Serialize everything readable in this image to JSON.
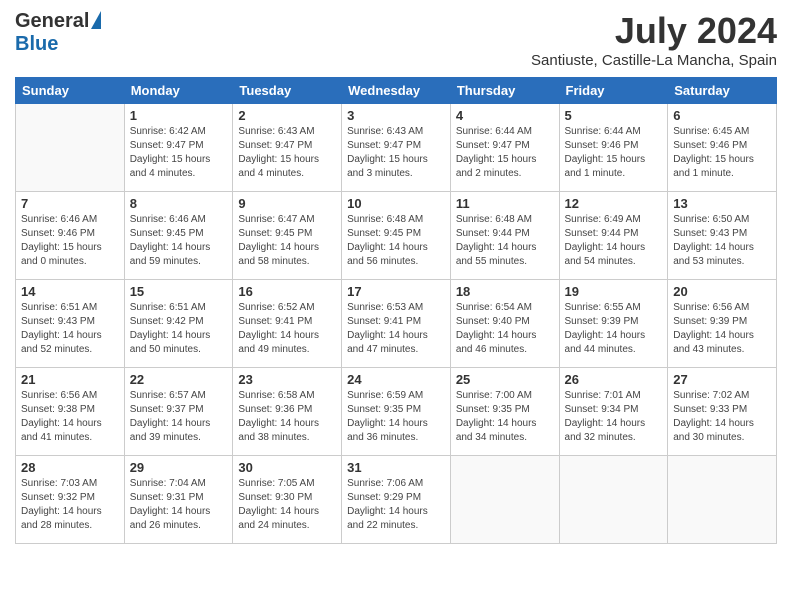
{
  "header": {
    "logo_general": "General",
    "logo_blue": "Blue",
    "month_year": "July 2024",
    "location": "Santiuste, Castille-La Mancha, Spain"
  },
  "weekdays": [
    "Sunday",
    "Monday",
    "Tuesday",
    "Wednesday",
    "Thursday",
    "Friday",
    "Saturday"
  ],
  "weeks": [
    [
      {
        "day": "",
        "info": ""
      },
      {
        "day": "1",
        "info": "Sunrise: 6:42 AM\nSunset: 9:47 PM\nDaylight: 15 hours\nand 4 minutes."
      },
      {
        "day": "2",
        "info": "Sunrise: 6:43 AM\nSunset: 9:47 PM\nDaylight: 15 hours\nand 4 minutes."
      },
      {
        "day": "3",
        "info": "Sunrise: 6:43 AM\nSunset: 9:47 PM\nDaylight: 15 hours\nand 3 minutes."
      },
      {
        "day": "4",
        "info": "Sunrise: 6:44 AM\nSunset: 9:47 PM\nDaylight: 15 hours\nand 2 minutes."
      },
      {
        "day": "5",
        "info": "Sunrise: 6:44 AM\nSunset: 9:46 PM\nDaylight: 15 hours\nand 1 minute."
      },
      {
        "day": "6",
        "info": "Sunrise: 6:45 AM\nSunset: 9:46 PM\nDaylight: 15 hours\nand 1 minute."
      }
    ],
    [
      {
        "day": "7",
        "info": "Sunrise: 6:46 AM\nSunset: 9:46 PM\nDaylight: 15 hours\nand 0 minutes."
      },
      {
        "day": "8",
        "info": "Sunrise: 6:46 AM\nSunset: 9:45 PM\nDaylight: 14 hours\nand 59 minutes."
      },
      {
        "day": "9",
        "info": "Sunrise: 6:47 AM\nSunset: 9:45 PM\nDaylight: 14 hours\nand 58 minutes."
      },
      {
        "day": "10",
        "info": "Sunrise: 6:48 AM\nSunset: 9:45 PM\nDaylight: 14 hours\nand 56 minutes."
      },
      {
        "day": "11",
        "info": "Sunrise: 6:48 AM\nSunset: 9:44 PM\nDaylight: 14 hours\nand 55 minutes."
      },
      {
        "day": "12",
        "info": "Sunrise: 6:49 AM\nSunset: 9:44 PM\nDaylight: 14 hours\nand 54 minutes."
      },
      {
        "day": "13",
        "info": "Sunrise: 6:50 AM\nSunset: 9:43 PM\nDaylight: 14 hours\nand 53 minutes."
      }
    ],
    [
      {
        "day": "14",
        "info": "Sunrise: 6:51 AM\nSunset: 9:43 PM\nDaylight: 14 hours\nand 52 minutes."
      },
      {
        "day": "15",
        "info": "Sunrise: 6:51 AM\nSunset: 9:42 PM\nDaylight: 14 hours\nand 50 minutes."
      },
      {
        "day": "16",
        "info": "Sunrise: 6:52 AM\nSunset: 9:41 PM\nDaylight: 14 hours\nand 49 minutes."
      },
      {
        "day": "17",
        "info": "Sunrise: 6:53 AM\nSunset: 9:41 PM\nDaylight: 14 hours\nand 47 minutes."
      },
      {
        "day": "18",
        "info": "Sunrise: 6:54 AM\nSunset: 9:40 PM\nDaylight: 14 hours\nand 46 minutes."
      },
      {
        "day": "19",
        "info": "Sunrise: 6:55 AM\nSunset: 9:39 PM\nDaylight: 14 hours\nand 44 minutes."
      },
      {
        "day": "20",
        "info": "Sunrise: 6:56 AM\nSunset: 9:39 PM\nDaylight: 14 hours\nand 43 minutes."
      }
    ],
    [
      {
        "day": "21",
        "info": "Sunrise: 6:56 AM\nSunset: 9:38 PM\nDaylight: 14 hours\nand 41 minutes."
      },
      {
        "day": "22",
        "info": "Sunrise: 6:57 AM\nSunset: 9:37 PM\nDaylight: 14 hours\nand 39 minutes."
      },
      {
        "day": "23",
        "info": "Sunrise: 6:58 AM\nSunset: 9:36 PM\nDaylight: 14 hours\nand 38 minutes."
      },
      {
        "day": "24",
        "info": "Sunrise: 6:59 AM\nSunset: 9:35 PM\nDaylight: 14 hours\nand 36 minutes."
      },
      {
        "day": "25",
        "info": "Sunrise: 7:00 AM\nSunset: 9:35 PM\nDaylight: 14 hours\nand 34 minutes."
      },
      {
        "day": "26",
        "info": "Sunrise: 7:01 AM\nSunset: 9:34 PM\nDaylight: 14 hours\nand 32 minutes."
      },
      {
        "day": "27",
        "info": "Sunrise: 7:02 AM\nSunset: 9:33 PM\nDaylight: 14 hours\nand 30 minutes."
      }
    ],
    [
      {
        "day": "28",
        "info": "Sunrise: 7:03 AM\nSunset: 9:32 PM\nDaylight: 14 hours\nand 28 minutes."
      },
      {
        "day": "29",
        "info": "Sunrise: 7:04 AM\nSunset: 9:31 PM\nDaylight: 14 hours\nand 26 minutes."
      },
      {
        "day": "30",
        "info": "Sunrise: 7:05 AM\nSunset: 9:30 PM\nDaylight: 14 hours\nand 24 minutes."
      },
      {
        "day": "31",
        "info": "Sunrise: 7:06 AM\nSunset: 9:29 PM\nDaylight: 14 hours\nand 22 minutes."
      },
      {
        "day": "",
        "info": ""
      },
      {
        "day": "",
        "info": ""
      },
      {
        "day": "",
        "info": ""
      }
    ]
  ]
}
